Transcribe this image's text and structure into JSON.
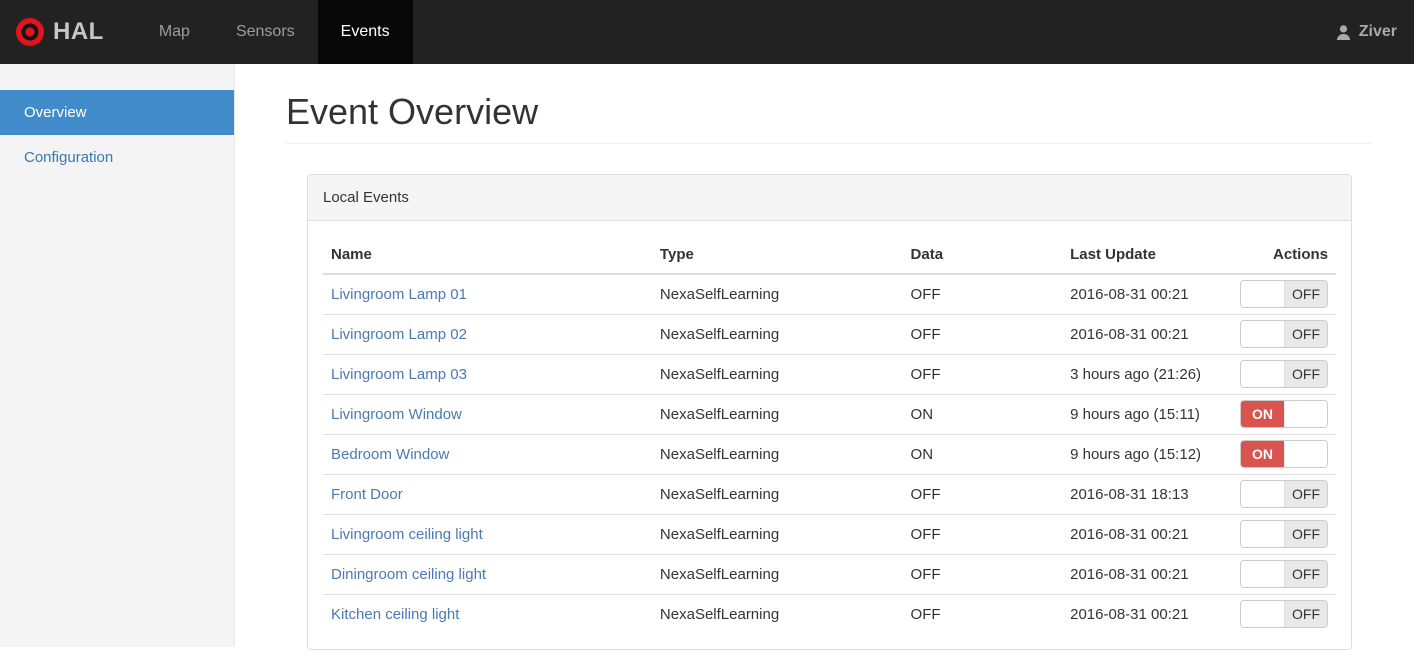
{
  "navbar": {
    "brand": "HAL",
    "items": [
      {
        "label": "Map",
        "active": false
      },
      {
        "label": "Sensors",
        "active": false
      },
      {
        "label": "Events",
        "active": true
      }
    ],
    "user": "Ziver"
  },
  "sidebar": {
    "items": [
      {
        "label": "Overview",
        "active": true
      },
      {
        "label": "Configuration",
        "active": false
      }
    ]
  },
  "main": {
    "title": "Event Overview",
    "panel": {
      "title": "Local Events",
      "table": {
        "columns": [
          "Name",
          "Type",
          "Data",
          "Last Update",
          "Actions"
        ],
        "rows": [
          {
            "name": "Livingroom Lamp 01",
            "type": "NexaSelfLearning",
            "data": "OFF",
            "last_update": "2016-08-31 00:21",
            "toggle": "OFF"
          },
          {
            "name": "Livingroom Lamp 02",
            "type": "NexaSelfLearning",
            "data": "OFF",
            "last_update": "2016-08-31 00:21",
            "toggle": "OFF"
          },
          {
            "name": "Livingroom Lamp 03",
            "type": "NexaSelfLearning",
            "data": "OFF",
            "last_update": "3 hours ago (21:26)",
            "toggle": "OFF"
          },
          {
            "name": "Livingroom Window",
            "type": "NexaSelfLearning",
            "data": "ON",
            "last_update": "9 hours ago (15:11)",
            "toggle": "ON"
          },
          {
            "name": "Bedroom Window",
            "type": "NexaSelfLearning",
            "data": "ON",
            "last_update": "9 hours ago (15:12)",
            "toggle": "ON"
          },
          {
            "name": "Front Door",
            "type": "NexaSelfLearning",
            "data": "OFF",
            "last_update": "2016-08-31 18:13",
            "toggle": "OFF"
          },
          {
            "name": "Livingroom ceiling light",
            "type": "NexaSelfLearning",
            "data": "OFF",
            "last_update": "2016-08-31 00:21",
            "toggle": "OFF"
          },
          {
            "name": "Diningroom ceiling light",
            "type": "NexaSelfLearning",
            "data": "OFF",
            "last_update": "2016-08-31 00:21",
            "toggle": "OFF"
          },
          {
            "name": "Kitchen ceiling light",
            "type": "NexaSelfLearning",
            "data": "OFF",
            "last_update": "2016-08-31 00:21",
            "toggle": "OFF"
          }
        ]
      }
    }
  },
  "colors": {
    "navbar_bg": "#222222",
    "navbar_active_bg": "#080808",
    "sidebar_active_bg": "#428bca",
    "link": "#337ab7",
    "toggle_on": "#d9534f",
    "toggle_off": "#e8e8e8",
    "logo_red": "#e3131e"
  }
}
